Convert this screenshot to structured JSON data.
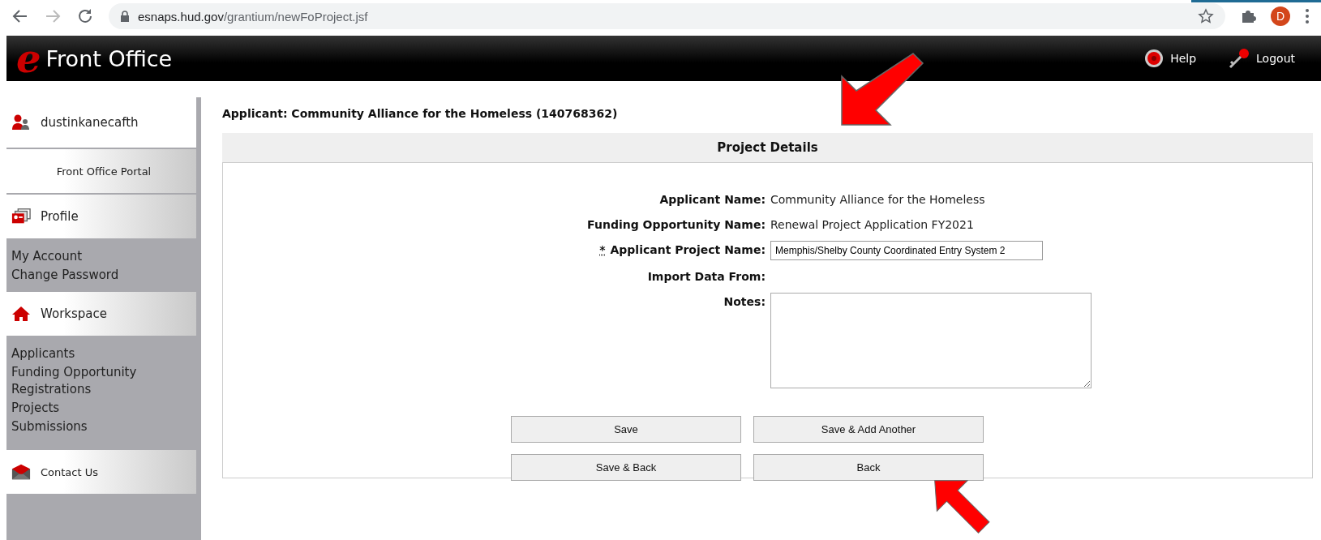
{
  "browser": {
    "url_host": "esnaps.hud.gov",
    "url_path": "/grantium/newFoProject.jsf",
    "avatar": "D"
  },
  "header": {
    "logo_letter": "e",
    "title": "Front Office",
    "actions": [
      {
        "kind": "help",
        "label": "Help"
      },
      {
        "kind": "logout",
        "label": "Logout"
      }
    ]
  },
  "sidebar": {
    "sections": [
      {
        "kind": "user",
        "label": "dustinkanecafth"
      },
      {
        "kind": "portal",
        "label": "Front Office Portal"
      },
      {
        "kind": "profile",
        "label": "Profile",
        "items": [
          "My Account",
          "Change Password"
        ]
      },
      {
        "kind": "workspace",
        "label": "Workspace",
        "items": [
          "Applicants",
          "Funding Opportunity Registrations",
          "Projects",
          "Submissions"
        ]
      },
      {
        "kind": "contact",
        "label": "Contact Us"
      }
    ]
  },
  "applicant_heading": "Applicant: Community Alliance for the Homeless (140768362)",
  "panel": {
    "title": "Project Details",
    "fields": [
      {
        "kind": "text",
        "label": "Applicant Name:",
        "value": "Community Alliance for the Homeless"
      },
      {
        "kind": "text",
        "label": "Funding Opportunity Name:",
        "value": "Renewal Project Application FY2021"
      },
      {
        "kind": "input",
        "required_mark": "*",
        "label": "Applicant Project Name:",
        "value": "Memphis/Shelby County Coordinated Entry System 2"
      },
      {
        "kind": "text",
        "label": "Import Data From:"
      },
      {
        "kind": "textarea",
        "label": "Notes:"
      }
    ],
    "buttons": [
      "Save",
      "Save & Add Another",
      "Save & Back",
      "Back"
    ]
  }
}
